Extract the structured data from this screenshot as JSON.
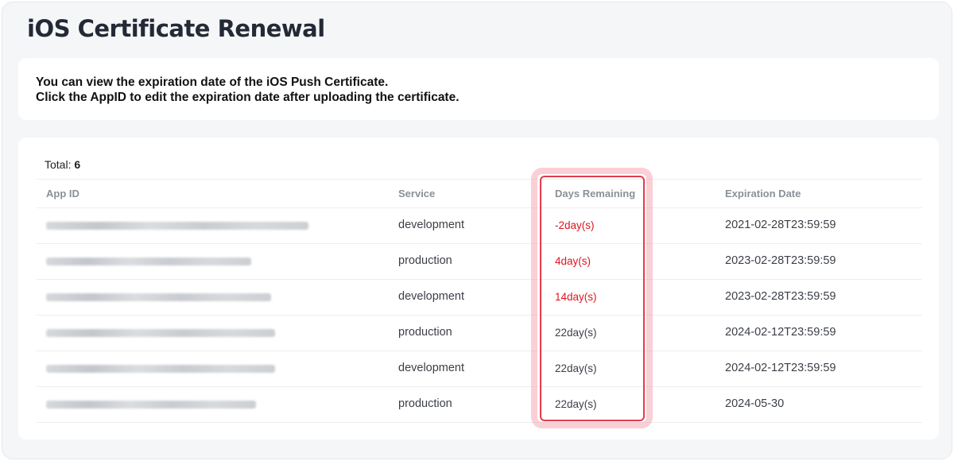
{
  "page": {
    "title": "iOS Certificate Renewal"
  },
  "info": {
    "line1": "You can view the expiration date of the iOS Push Certificate.",
    "line2": "Click the AppID to edit the expiration date after uploading the certificate."
  },
  "table": {
    "total_label": "Total:",
    "total_count": "6",
    "headers": {
      "app_id": "App ID",
      "service": "Service",
      "days_remaining": "Days Remaining",
      "expiration_date": "Expiration Date"
    },
    "rows": [
      {
        "service": "development",
        "days": "-2day(s)",
        "expiration": "2021-02-28T23:59:59",
        "status_color": "#e0141e"
      },
      {
        "service": "production",
        "days": "4day(s)",
        "expiration": "2023-02-28T23:59:59",
        "status_color": "#e0141e"
      },
      {
        "service": "development",
        "days": "14day(s)",
        "expiration": "2023-02-28T23:59:59",
        "status_color": "#e0141e"
      },
      {
        "service": "production",
        "days": "22day(s)",
        "expiration": "2024-02-12T23:59:59",
        "status_color": "#3b3f46"
      },
      {
        "service": "development",
        "days": "22day(s)",
        "expiration": "2024-02-12T23:59:59",
        "status_color": "#3b3f46"
      },
      {
        "service": "production",
        "days": "22day(s)",
        "expiration": "2024-05-30",
        "status_color": "#3b3f46"
      }
    ]
  },
  "colors": {
    "accent_highlight": "#e33b4d",
    "expiring_text": "#e0141e"
  }
}
